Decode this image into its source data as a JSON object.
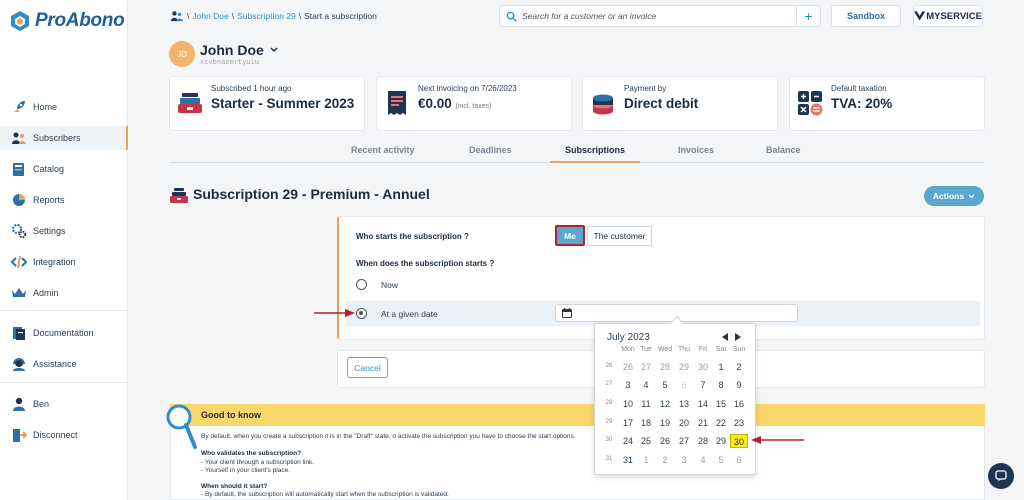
{
  "app": {
    "name": "ProAbono"
  },
  "sidebar": {
    "items": [
      {
        "label": "Home",
        "icon": "rocket-icon"
      },
      {
        "label": "Subscribers",
        "icon": "subscribers-icon",
        "active": true
      },
      {
        "label": "Catalog",
        "icon": "catalog-icon"
      },
      {
        "label": "Reports",
        "icon": "pie-chart-icon"
      },
      {
        "label": "Settings",
        "icon": "gear-icon"
      },
      {
        "label": "Integration",
        "icon": "code-icon"
      },
      {
        "label": "Admin",
        "icon": "crown-icon"
      },
      {
        "label": "Documentation",
        "icon": "documentation-icon"
      },
      {
        "label": "Assistance",
        "icon": "headset-icon"
      },
      {
        "label": "Ben",
        "icon": "user-icon"
      },
      {
        "label": "Disconnect",
        "icon": "disconnect-icon"
      }
    ]
  },
  "breadcrumb": {
    "sep": "\\",
    "items": [
      "John Doe",
      "Subscription 29",
      "Start a subscription"
    ]
  },
  "search": {
    "placeholder": "Search for a customer or an invoice",
    "add": "+"
  },
  "topbar": {
    "sandbox": "Sandbox",
    "brand": "MYSERVICE"
  },
  "customer": {
    "initials": "JD",
    "name": "John Doe",
    "ref": "xcvbnazertyuiu"
  },
  "cards": [
    {
      "label": "Subscribed 1 hour ago",
      "value": "Starter - Summer 2023",
      "suffix": "",
      "icon": "subscription-stack-icon"
    },
    {
      "label": "Next invoicing on 7/26/2023",
      "value": "€0.00",
      "suffix": "(incl. taxes)",
      "icon": "invoice-icon"
    },
    {
      "label": "Payment by",
      "value": "Direct debit",
      "suffix": "",
      "icon": "coins-icon"
    },
    {
      "label": "Default taxation",
      "value": "TVA: 20%",
      "suffix": "",
      "icon": "calculator-icon"
    }
  ],
  "tabs": [
    "Recent activity",
    "Deadlines",
    "Subscriptions",
    "Invoices",
    "Balance"
  ],
  "active_tab": "Subscriptions",
  "subscription": {
    "title": "Subscription 29 - Premium - Annuel",
    "actions": "Actions"
  },
  "form": {
    "who_label": "Who starts the subscription ?",
    "me": "Me",
    "the_customer": "The customer",
    "when_label": "When does the subscription starts ?",
    "now": "Now",
    "given_date": "At a given date",
    "cancel": "Cancel"
  },
  "datepicker": {
    "month": "July 2023",
    "days_of_week": [
      "Mon",
      "Tue",
      "Wed",
      "Thu",
      "Fri",
      "Sat",
      "Sun"
    ],
    "weeks": [
      {
        "num": "26",
        "days": [
          "26",
          "27",
          "28",
          "29",
          "30",
          "1",
          "2"
        ]
      },
      {
        "num": "27",
        "days": [
          "3",
          "4",
          "5",
          "6",
          "7",
          "8",
          "9"
        ]
      },
      {
        "num": "28",
        "days": [
          "10",
          "11",
          "12",
          "13",
          "14",
          "15",
          "16"
        ]
      },
      {
        "num": "29",
        "days": [
          "17",
          "18",
          "19",
          "20",
          "21",
          "22",
          "23"
        ]
      },
      {
        "num": "30",
        "days": [
          "24",
          "25",
          "26",
          "27",
          "28",
          "29",
          "30"
        ]
      },
      {
        "num": "31",
        "days": [
          "31",
          "1",
          "2",
          "3",
          "4",
          "5",
          "6"
        ]
      }
    ],
    "selected": "30"
  },
  "good_to_know": {
    "title": "Good to know",
    "intro": "By default, when you create a subscription it is in the \"Draft\" state. o activate the subscription you have to choose the start options.",
    "q1": "Who validates the subscription?",
    "a1_1": "- Your client through a subscription link.",
    "a1_2": "- Yourself in your client's place.",
    "q2": "When should it start?",
    "a2_1": "- By default, the subscription will automatically start when the subscription is validated."
  },
  "colors": {
    "accent": "#5aa8cf",
    "highlight_border": "#b3202a",
    "arrow": "#b3202a",
    "selected_day": "#f5ec18",
    "gtk_banner": "#fbd66a",
    "tab_active": "#e8a25a"
  }
}
